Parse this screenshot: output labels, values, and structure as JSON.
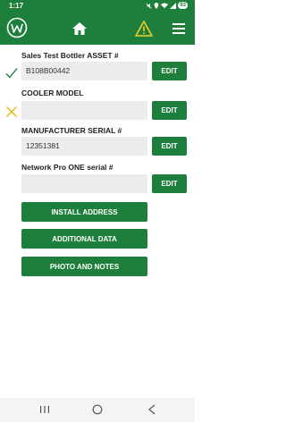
{
  "status_bar": {
    "time": "1:17",
    "battery": "93",
    "icons": [
      "mute-icon",
      "location-icon",
      "wifi-icon",
      "signal-icon",
      "battery-icon"
    ]
  },
  "app_bar": {
    "logo_icon": "app-logo-w",
    "home_icon": "home-icon",
    "warning_icon": "warning-triangle-icon",
    "menu_icon": "hamburger-menu-icon",
    "warning_color": "#f2d024"
  },
  "fields": [
    {
      "label": "Sales Test Bottler ASSET #",
      "value": "B108B00442",
      "status": "check",
      "edit_label": "EDIT"
    },
    {
      "label": "COOLER MODEL",
      "value": "",
      "status": "cross",
      "edit_label": "EDIT"
    },
    {
      "label": "MANUFACTURER SERIAL #",
      "value": "12351381",
      "status": "none",
      "edit_label": "EDIT"
    },
    {
      "label": "Network Pro ONE serial #",
      "value": "",
      "status": "none",
      "edit_label": "EDIT"
    }
  ],
  "actions": {
    "install_address": "INSTALL ADDRESS",
    "additional_data": "ADDITIONAL DATA",
    "photo_and_notes": "PHOTO AND NOTES"
  },
  "colors": {
    "brand_green": "#1e7f3c",
    "check_green": "#1e7f3c",
    "cross_yellow": "#e6b800"
  },
  "nav_bar": {
    "icons": [
      "recent-apps-icon",
      "home-circle-icon",
      "back-icon"
    ]
  }
}
